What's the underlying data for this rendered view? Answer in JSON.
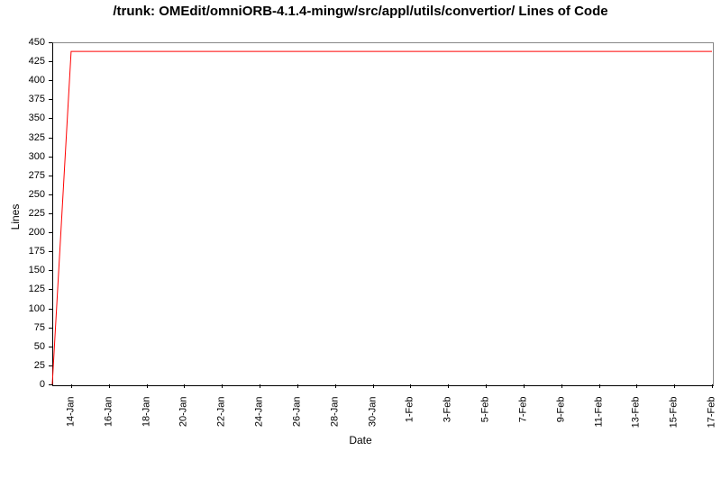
{
  "chart_data": {
    "type": "line",
    "title": "/trunk: OMEdit/omniORB-4.1.4-mingw/src/appl/utils/convertior/ Lines of Code",
    "xlabel": "Date",
    "ylabel": "Lines",
    "ylim": [
      0,
      450
    ],
    "y_ticks": [
      0,
      25,
      50,
      75,
      100,
      125,
      150,
      175,
      200,
      225,
      250,
      275,
      300,
      325,
      350,
      375,
      400,
      425,
      450
    ],
    "x_ticks": [
      "14-Jan",
      "16-Jan",
      "18-Jan",
      "20-Jan",
      "22-Jan",
      "24-Jan",
      "26-Jan",
      "28-Jan",
      "30-Jan",
      "1-Feb",
      "3-Feb",
      "5-Feb",
      "7-Feb",
      "9-Feb",
      "11-Feb",
      "13-Feb",
      "15-Feb",
      "17-Feb"
    ],
    "series": [
      {
        "name": "Lines of Code",
        "color": "#ff0000",
        "points": [
          {
            "x": "13-Jan",
            "y": 0
          },
          {
            "x": "14-Jan",
            "y": 438
          },
          {
            "x": "17-Feb",
            "y": 438
          }
        ]
      }
    ]
  }
}
